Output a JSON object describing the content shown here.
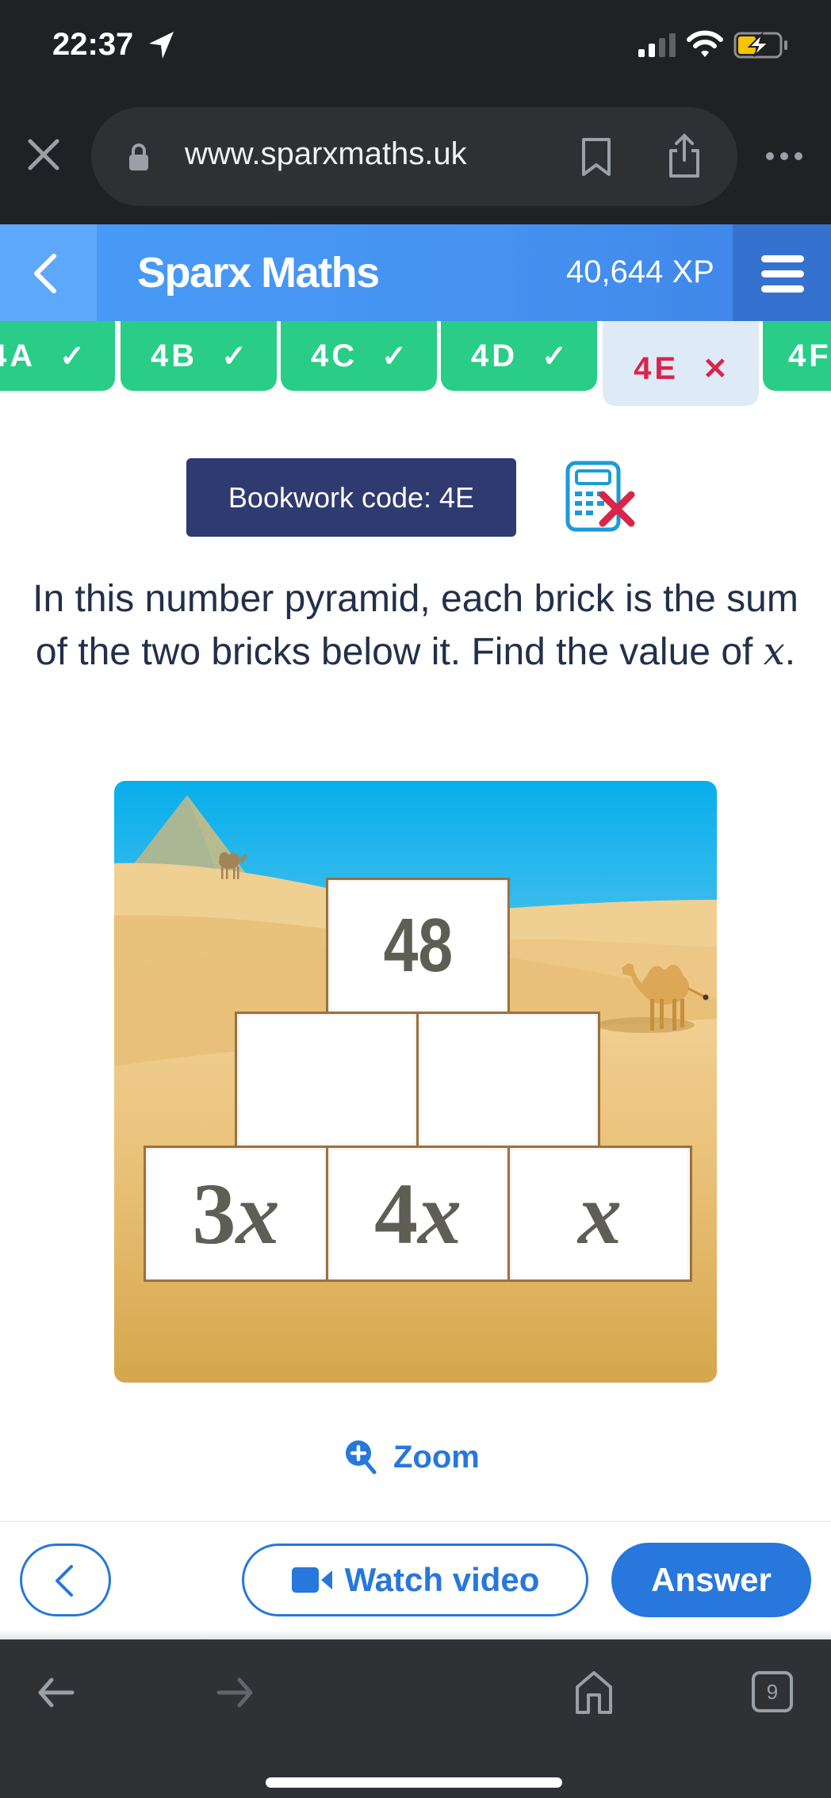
{
  "status_bar": {
    "time": "22:37",
    "icons": [
      "location-arrow-icon",
      "cellular-signal-icon",
      "wifi-icon",
      "battery-charging-icon"
    ]
  },
  "browser": {
    "url": "www.sparxmaths.uk",
    "icons": [
      "close-icon",
      "lock-icon",
      "bookmark-icon",
      "share-icon",
      "more-icon"
    ],
    "bottom_bar": {
      "tab_count": "9",
      "icons": [
        "back-arrow-icon",
        "forward-arrow-icon",
        "home-icon",
        "tabs-icon"
      ]
    }
  },
  "header": {
    "title": "Sparx Maths",
    "xp": "40,644 XP",
    "colors": {
      "primary": "#4592f1",
      "menu": "#3572d0"
    }
  },
  "tabs": [
    {
      "label": "4A",
      "status": "correct",
      "mark": "✓"
    },
    {
      "label": "4B",
      "status": "correct",
      "mark": "✓"
    },
    {
      "label": "4C",
      "status": "correct",
      "mark": "✓"
    },
    {
      "label": "4D",
      "status": "correct",
      "mark": "✓"
    },
    {
      "label": "4E",
      "status": "incorrect",
      "mark": "✕",
      "active": true
    },
    {
      "label": "4F",
      "status": "correct",
      "mark": ""
    }
  ],
  "bookwork": {
    "label": "Bookwork code: 4E",
    "calculator_status": "calculator-not-allowed"
  },
  "question": {
    "text_before": "In this number pyramid, each brick is the sum of the two bricks below it. Find the value of ",
    "variable": "x",
    "text_after": "."
  },
  "pyramid": {
    "top": "48",
    "middle": [
      "",
      ""
    ],
    "bottom": [
      {
        "coef": "3",
        "var": "x"
      },
      {
        "coef": "4",
        "var": "x"
      },
      {
        "coef": "",
        "var": "x"
      }
    ]
  },
  "zoom": {
    "label": "Zoom"
  },
  "actions": {
    "back_label": "",
    "watch_video_label": "Watch video",
    "answer_label": "Answer",
    "accent": "#2777dc"
  }
}
